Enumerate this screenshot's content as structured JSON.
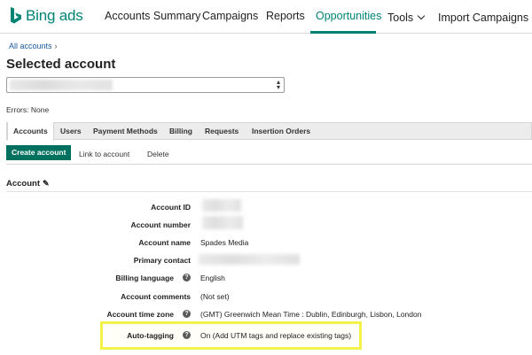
{
  "brand": {
    "name": "Bing ads",
    "accent": "#008373"
  },
  "nav": {
    "items": [
      {
        "label": "Accounts Summary"
      },
      {
        "label": "Campaigns"
      },
      {
        "label": "Reports"
      },
      {
        "label": "Opportunities"
      },
      {
        "label": "Tools"
      },
      {
        "label": "Import Campaigns"
      }
    ],
    "active": "Opportunities"
  },
  "breadcrumb": {
    "label": "All accounts",
    "separator": "›"
  },
  "page": {
    "title": "Selected account"
  },
  "status": {
    "errors": "Errors: None"
  },
  "tabs": [
    {
      "label": "Accounts",
      "active": true
    },
    {
      "label": "Users"
    },
    {
      "label": "Payment Methods"
    },
    {
      "label": "Billing"
    },
    {
      "label": "Requests"
    },
    {
      "label": "Insertion Orders"
    }
  ],
  "actions": {
    "create": "Create account",
    "link": "Link to account",
    "delete": "Delete"
  },
  "section": {
    "title": "Account"
  },
  "details": {
    "account_id": {
      "label": "Account ID"
    },
    "account_number": {
      "label": "Account number"
    },
    "account_name": {
      "label": "Account name",
      "value": "Spades Media"
    },
    "primary_contact": {
      "label": "Primary contact"
    },
    "billing_language": {
      "label": "Billing language",
      "value": "English"
    },
    "account_comments": {
      "label": "Account comments",
      "value": "(Not set)"
    },
    "time_zone": {
      "label": "Account time zone",
      "value": "(GMT) Greenwich Mean Time : Dublin, Edinburgh, Lisbon, London"
    },
    "auto_tagging": {
      "label": "Auto-tagging",
      "value": "On (Add UTM tags and replace existing tags)"
    }
  }
}
